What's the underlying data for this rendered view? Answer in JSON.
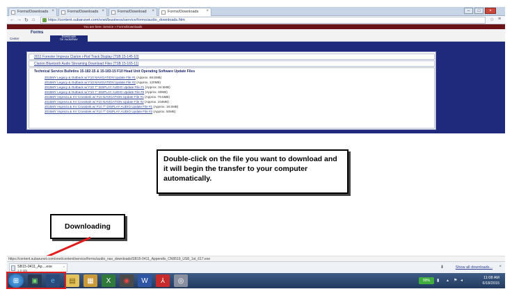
{
  "browser": {
    "tabs": [
      {
        "label": "Forms/Downloads",
        "active": false
      },
      {
        "label": "Forms/Downloads",
        "active": false
      },
      {
        "label": "Forms/Download",
        "active": false
      },
      {
        "label": "Forms/Downloads",
        "active": true
      }
    ],
    "url": "https://content.subarunet.com/snet/business/service/forms/audio_downloads.htm",
    "back_icon": "back-arrow-icon",
    "forward_icon": "forward-arrow-icon",
    "reload_icon": "reload-icon",
    "home_icon": "home-icon"
  },
  "site": {
    "location_msg": "You are here:  Service » Forms/Downloads",
    "nav_forms": "Forms",
    "nav_center": "Center",
    "nav_downloads_line1": "Downloads",
    "nav_downloads_line2": "for Audio/Nav"
  },
  "content": {
    "doc_links": [
      "2011 Forester Impreza Clarion i-Pod Track Display (TSB 15-145-10)",
      "Clarion Bluetooth Audio Streaming Download Files (TSB 15-165-11)"
    ],
    "tsb_header": "Technical Service Bulletins 15-182-15 & 15-183-15 F10 Head Unit Operating Software Update Files",
    "files": [
      {
        "name": "2015MY Legacy & Outback w/ F10 NAVIGATION Update File #1",
        "size": "(Approx. 68.5MB)"
      },
      {
        "name": "2015MY Legacy & Outback w/ F10 NAVIGATION Update File #2",
        "size": "(Approx. 120MB)"
      },
      {
        "name": "2015MY Legacy & Outback w/ F10 7\" DISPLAY AUDIO Update File #1",
        "size": "(Approx. 34.5MB)"
      },
      {
        "name": "2015MY Legacy & Outback w/ F10 7\" DISPLAY AUDIO Update File #2",
        "size": "(Approx. 60MB)"
      },
      {
        "name": "2015MY Impreza & XV Crosstrek w/ F10 NAVIGATION Update File #1",
        "size": "(Approx. 79.5MB)"
      },
      {
        "name": "2015MY Impreza & XV Crosstrek w/ F10 NAVIGATION Update File #2",
        "size": "(Approx. 104MB)"
      },
      {
        "name": "2015MY Impreza & XV Crosstrek w/ F10 7\" DISPLAY AUDIO Update File #1",
        "size": "(Approx. 18.5MB)"
      },
      {
        "name": "2015MY Impreza & XV Crosstrek w/ F10 7\" DISPLAY AUDIO Update File #2",
        "size": "(Approx. 50MB)"
      }
    ]
  },
  "annotations": {
    "main_callout": "Double-click on the file you want to download and it will begin the transfer to your computer automatically.",
    "downloading_callout": "Downloading",
    "arrow_color": "#e01c1c"
  },
  "status": {
    "url": "https://content.subarunet.com/snet/content/service/forms/audio_nav_downloads/SB15-0411_Appendix_CN9519_US8_1st_617.exe"
  },
  "download_bar": {
    "filename": "SB15-0411_Ap....exe",
    "progress": "3.9 MB",
    "show_all": "Show all downloads..."
  },
  "taskbar": {
    "battery": "99%",
    "time": "11:08 AM",
    "date": "6/18/2015"
  }
}
